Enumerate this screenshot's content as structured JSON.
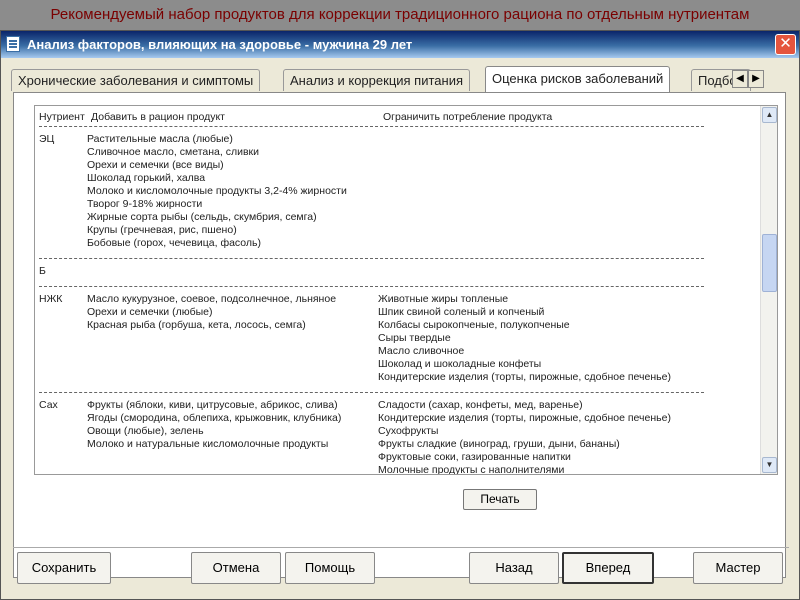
{
  "slide_title": "Рекомендуемый набор продуктов для коррекции традиционного рациона по отдельным нутриентам",
  "window": {
    "title": "Анализ факторов, влияющих на здоровье - мужчина 29 лет",
    "close": "✕"
  },
  "tabs": [
    {
      "label": "Хронические заболевания и симптомы",
      "active": false
    },
    {
      "label": "Анализ и коррекция питания",
      "active": false
    },
    {
      "label": "Оценка рисков заболеваний",
      "active": true
    },
    {
      "label": "Подбор",
      "active": false
    }
  ],
  "tab_arrows": {
    "left": "◀",
    "right": "▶"
  },
  "list": {
    "headers": {
      "nutrient": "Нутриент",
      "add": "Добавить в рацион продукт",
      "limit": "Ограничить потребление продукта"
    },
    "groups": [
      {
        "nutrient": "ЭЦ",
        "add": [
          "Растительные масла (любые)",
          "Сливочное масло, сметана, сливки",
          "Орехи и семечки (все виды)",
          "Шоколад горький, халва",
          "Молоко и кисломолочные продукты 3,2-4% жирности",
          "Творог 9-18% жирности",
          "Жирные сорта рыбы (сельдь, скумбрия, семга)",
          "Крупы (гречневая, рис, пшено)",
          "Бобовые (горох, чечевица, фасоль)"
        ],
        "limit": []
      },
      {
        "nutrient": "Б",
        "add": [],
        "limit": []
      },
      {
        "nutrient": "НЖК",
        "add": [
          "Масло кукурузное, соевое, подсолнечное, льняное",
          "Орехи и семечки (любые)",
          "Красная рыба (горбуша, кета, лосось, семга)"
        ],
        "limit": [
          "Животные жиры топленые",
          "Шпик свиной соленый и копченый",
          "Колбасы сырокопченые, полукопченые",
          "Сыры твердые",
          "Масло сливочное",
          "Шоколад и шоколадные конфеты",
          "Кондитерские изделия (торты, пирожные, сдобное печенье)"
        ]
      },
      {
        "nutrient": "Сах",
        "add": [
          "Фрукты (яблоки, киви, цитрусовые, абрикос, слива)",
          "Ягоды (смородина, облепиха, крыжовник, клубника)",
          "Овощи (любые), зелень",
          "Молоко и натуральные кисломолочные продукты"
        ],
        "limit": [
          "Сладости (сахар, конфеты, мед, варенье)",
          "Кондитерские изделия (торты, пирожные, сдобное печенье)",
          "Сухофрукты",
          "Фрукты сладкие (виноград, груши, дыни, бананы)",
          "Фруктовые соки, газированные напитки",
          "Молочные продукты с наполнителями"
        ]
      }
    ]
  },
  "scrollbar": {
    "up": "▲",
    "down": "▼"
  },
  "print_button": "Печать",
  "buttons": {
    "save": "Сохранить",
    "cancel": "Отмена",
    "help": "Помощь",
    "back": "Назад",
    "forward": "Вперед",
    "wizard": "Мастер"
  },
  "colors": {
    "slide_title": "#7a0000",
    "titlebar": "#0a246a",
    "close_button": "#e5553d"
  }
}
